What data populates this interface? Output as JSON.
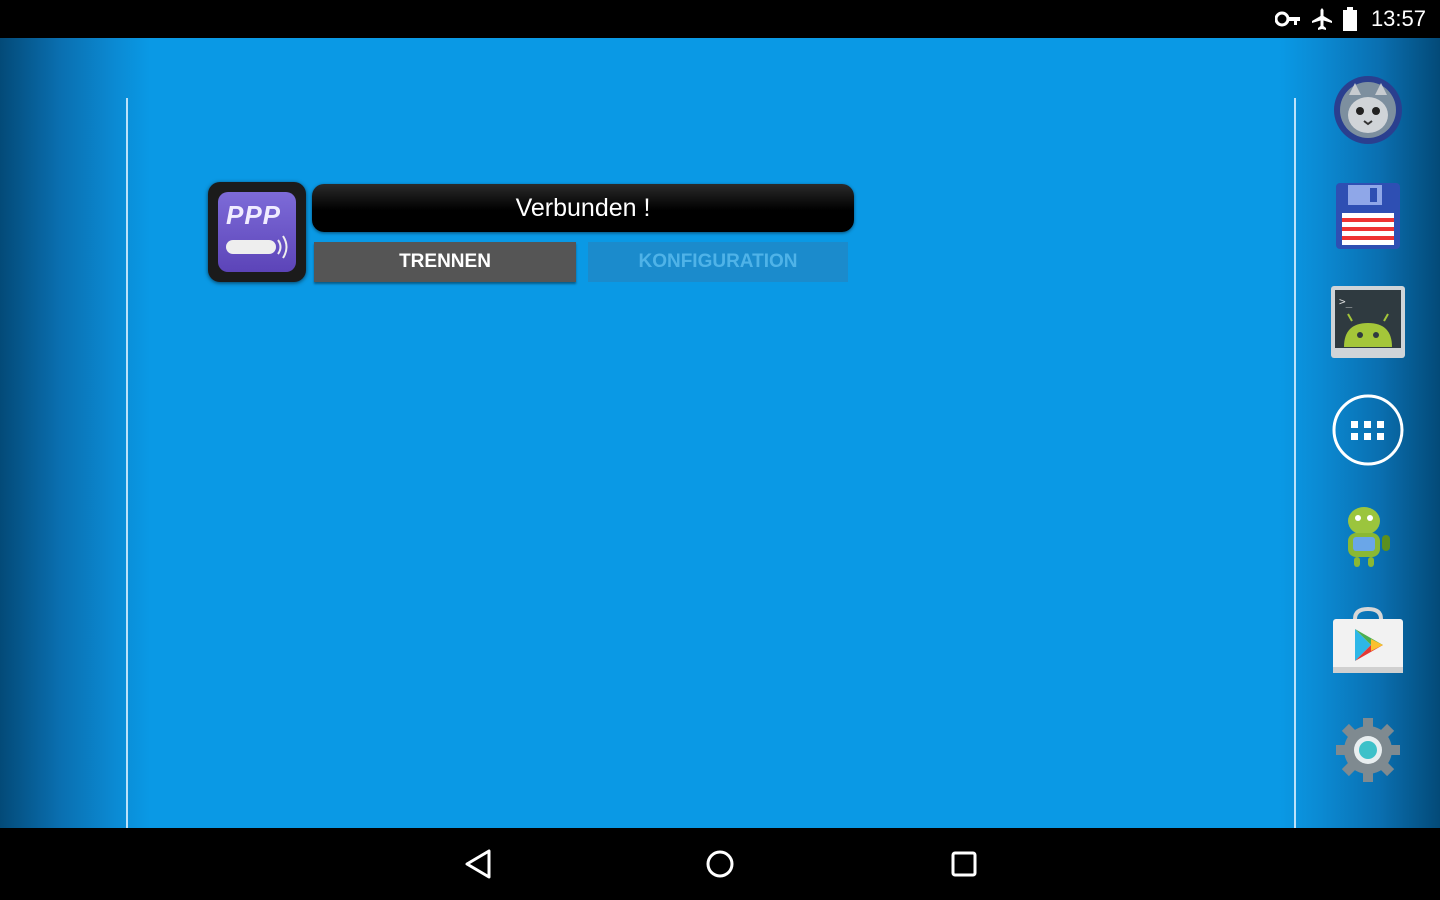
{
  "status_bar": {
    "time": "13:57",
    "icons": [
      "vpn-key-icon",
      "airplane-mode-icon",
      "battery-icon"
    ]
  },
  "widget": {
    "app_icon_text": "PPP",
    "status_text": "Verbunden !",
    "disconnect_label": "TRENNEN",
    "config_label": "KONFIGURATION"
  },
  "dock": {
    "items": [
      "cat-app-icon",
      "floppy-disk-icon",
      "terminal-emulator-icon",
      "app-drawer-icon",
      "android-robot-app-icon",
      "play-store-icon",
      "settings-gear-icon"
    ]
  },
  "nav_bar": {
    "buttons": [
      "back-icon",
      "home-icon",
      "recents-icon"
    ]
  },
  "colors": {
    "wallpaper": "#0a99e5",
    "disconnect_button": "#555555",
    "config_button": "#1b8bcc"
  }
}
